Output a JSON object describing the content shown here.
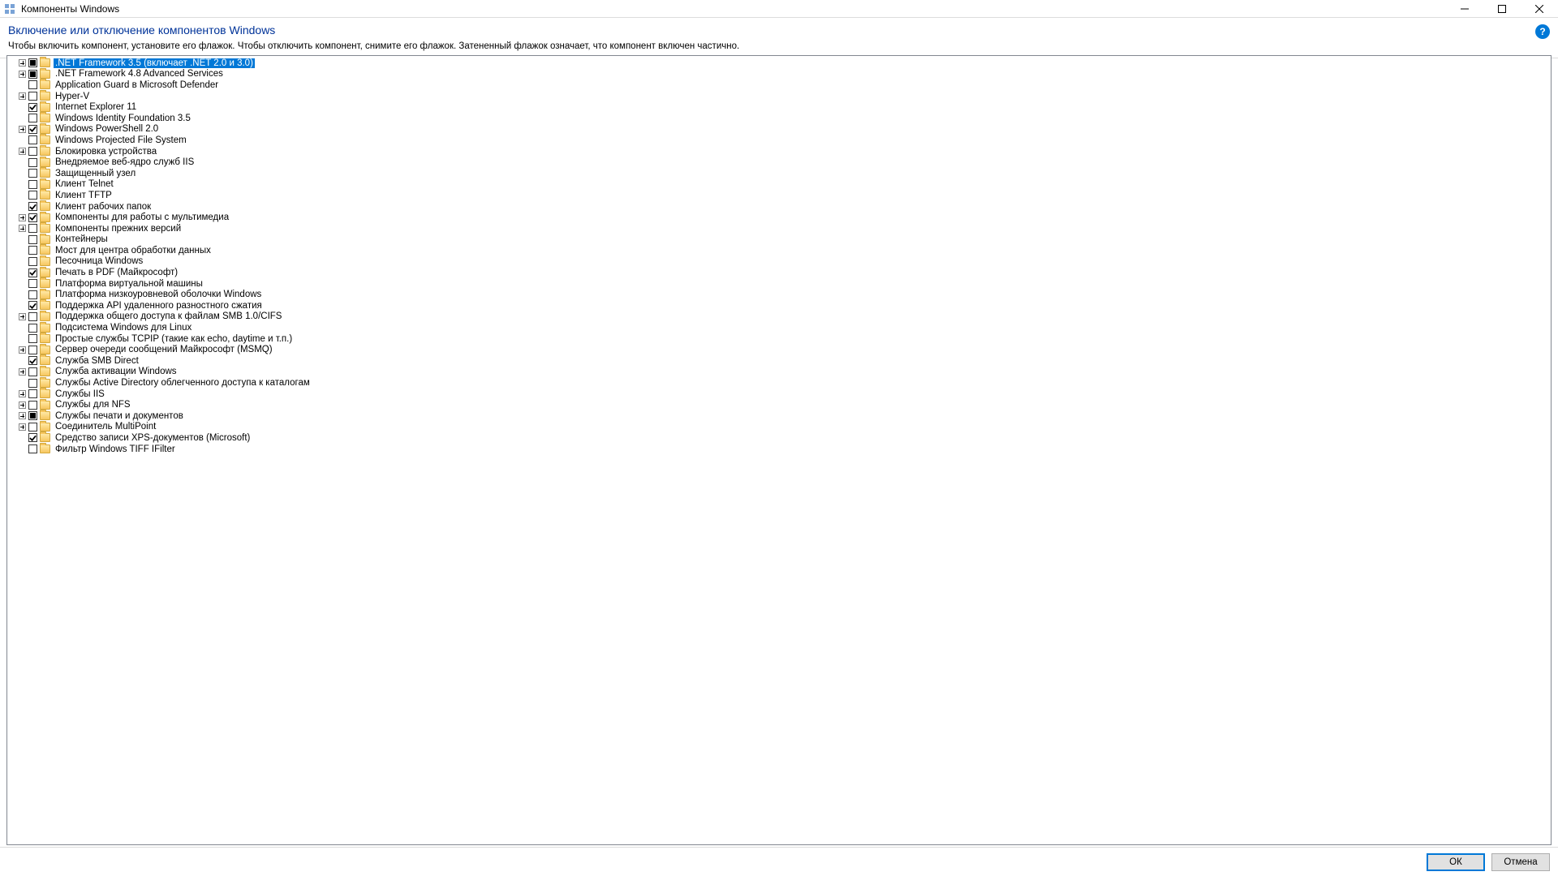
{
  "titlebar": {
    "title": "Компоненты Windows"
  },
  "header": {
    "heading": "Включение или отключение компонентов Windows",
    "description": "Чтобы включить компонент, установите его флажок. Чтобы отключить компонент, снимите его флажок. Затененный флажок означает, что компонент включен частично."
  },
  "help_tooltip": "?",
  "buttons": {
    "ok": "ОК",
    "cancel": "Отмена"
  },
  "features": [
    {
      "label": ".NET Framework 3.5 (включает .NET 2.0 и 3.0)",
      "expandable": true,
      "state": "partial",
      "selected": true
    },
    {
      "label": ".NET Framework 4.8 Advanced Services",
      "expandable": true,
      "state": "partial",
      "selected": false
    },
    {
      "label": "Application Guard в Microsoft Defender",
      "expandable": false,
      "state": "unchecked",
      "selected": false
    },
    {
      "label": "Hyper-V",
      "expandable": true,
      "state": "unchecked",
      "selected": false
    },
    {
      "label": "Internet Explorer 11",
      "expandable": false,
      "state": "checked",
      "selected": false
    },
    {
      "label": "Windows Identity Foundation 3.5",
      "expandable": false,
      "state": "unchecked",
      "selected": false
    },
    {
      "label": "Windows PowerShell 2.0",
      "expandable": true,
      "state": "checked",
      "selected": false
    },
    {
      "label": "Windows Projected File System",
      "expandable": false,
      "state": "unchecked",
      "selected": false
    },
    {
      "label": "Блокировка устройства",
      "expandable": true,
      "state": "unchecked",
      "selected": false
    },
    {
      "label": "Внедряемое веб-ядро служб IIS",
      "expandable": false,
      "state": "unchecked",
      "selected": false
    },
    {
      "label": "Защищенный узел",
      "expandable": false,
      "state": "unchecked",
      "selected": false
    },
    {
      "label": "Клиент Telnet",
      "expandable": false,
      "state": "unchecked",
      "selected": false
    },
    {
      "label": "Клиент TFTP",
      "expandable": false,
      "state": "unchecked",
      "selected": false
    },
    {
      "label": "Клиент рабочих папок",
      "expandable": false,
      "state": "checked",
      "selected": false
    },
    {
      "label": "Компоненты для работы с мультимедиа",
      "expandable": true,
      "state": "checked",
      "selected": false
    },
    {
      "label": "Компоненты прежних версий",
      "expandable": true,
      "state": "unchecked",
      "selected": false
    },
    {
      "label": "Контейнеры",
      "expandable": false,
      "state": "unchecked",
      "selected": false
    },
    {
      "label": "Мост для центра обработки данных",
      "expandable": false,
      "state": "unchecked",
      "selected": false
    },
    {
      "label": "Песочница Windows",
      "expandable": false,
      "state": "unchecked",
      "selected": false
    },
    {
      "label": "Печать в PDF (Майкрософт)",
      "expandable": false,
      "state": "checked",
      "selected": false
    },
    {
      "label": "Платформа виртуальной машины",
      "expandable": false,
      "state": "unchecked",
      "selected": false
    },
    {
      "label": "Платформа низкоуровневой оболочки Windows",
      "expandable": false,
      "state": "unchecked",
      "selected": false
    },
    {
      "label": "Поддержка API удаленного разностного сжатия",
      "expandable": false,
      "state": "checked",
      "selected": false
    },
    {
      "label": "Поддержка общего доступа к файлам SMB 1.0/CIFS",
      "expandable": true,
      "state": "unchecked",
      "selected": false
    },
    {
      "label": "Подсистема Windows для Linux",
      "expandable": false,
      "state": "unchecked",
      "selected": false
    },
    {
      "label": "Простые службы TCPIP (такие как echo, daytime и т.п.)",
      "expandable": false,
      "state": "unchecked",
      "selected": false
    },
    {
      "label": "Сервер очереди сообщений Майкрософт (MSMQ)",
      "expandable": true,
      "state": "unchecked",
      "selected": false
    },
    {
      "label": "Служба SMB Direct",
      "expandable": false,
      "state": "checked",
      "selected": false
    },
    {
      "label": "Служба активации Windows",
      "expandable": true,
      "state": "unchecked",
      "selected": false
    },
    {
      "label": "Службы Active Directory облегченного доступа к каталогам",
      "expandable": false,
      "state": "unchecked",
      "selected": false
    },
    {
      "label": "Службы IIS",
      "expandable": true,
      "state": "unchecked",
      "selected": false
    },
    {
      "label": "Службы для NFS",
      "expandable": true,
      "state": "unchecked",
      "selected": false
    },
    {
      "label": "Службы печати и документов",
      "expandable": true,
      "state": "partial",
      "selected": false
    },
    {
      "label": "Соединитель MultiPoint",
      "expandable": true,
      "state": "unchecked",
      "selected": false
    },
    {
      "label": "Средство записи XPS-документов (Microsoft)",
      "expandable": false,
      "state": "checked",
      "selected": false
    },
    {
      "label": "Фильтр Windows TIFF IFilter",
      "expandable": false,
      "state": "unchecked",
      "selected": false
    }
  ]
}
